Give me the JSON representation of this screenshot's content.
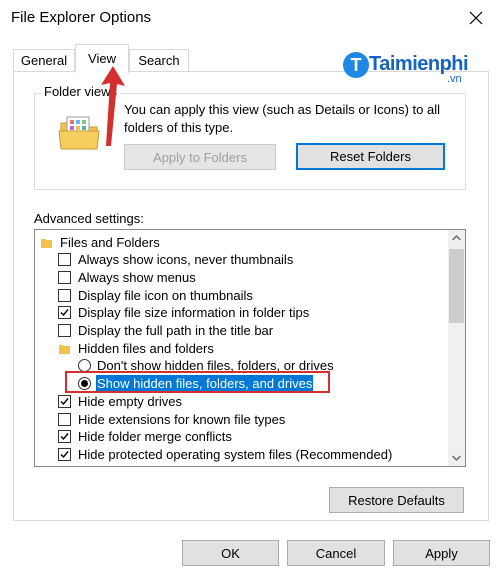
{
  "window": {
    "title": "File Explorer Options"
  },
  "tabs": [
    {
      "label": "General",
      "active": false
    },
    {
      "label": "View",
      "active": true
    },
    {
      "label": "Search",
      "active": false
    }
  ],
  "folder_views": {
    "legend": "Folder views",
    "description": "You can apply this view (such as Details or Icons) to all folders of this type.",
    "apply_button": "Apply to Folders",
    "reset_button": "Reset Folders"
  },
  "advanced": {
    "label": "Advanced settings:",
    "items": [
      {
        "type": "folder",
        "label": "Files and Folders",
        "indent": 0
      },
      {
        "type": "checkbox",
        "label": "Always show icons, never thumbnails",
        "checked": false,
        "indent": 1
      },
      {
        "type": "checkbox",
        "label": "Always show menus",
        "checked": false,
        "indent": 1
      },
      {
        "type": "checkbox",
        "label": "Display file icon on thumbnails",
        "checked": false,
        "indent": 1
      },
      {
        "type": "checkbox",
        "label": "Display file size information in folder tips",
        "checked": true,
        "indent": 1
      },
      {
        "type": "checkbox",
        "label": "Display the full path in the title bar",
        "checked": false,
        "indent": 1
      },
      {
        "type": "folder",
        "label": "Hidden files and folders",
        "indent": 1
      },
      {
        "type": "radio",
        "label": "Don't show hidden files, folders, or drives",
        "checked": false,
        "indent": 2
      },
      {
        "type": "radio",
        "label": "Show hidden files, folders, and drives",
        "checked": true,
        "selected": true,
        "indent": 2
      },
      {
        "type": "checkbox",
        "label": "Hide empty drives",
        "checked": true,
        "indent": 1
      },
      {
        "type": "checkbox",
        "label": "Hide extensions for known file types",
        "checked": false,
        "indent": 1
      },
      {
        "type": "checkbox",
        "label": "Hide folder merge conflicts",
        "checked": true,
        "indent": 1
      },
      {
        "type": "checkbox",
        "label": "Hide protected operating system files (Recommended)",
        "checked": true,
        "indent": 1
      }
    ],
    "restore_button": "Restore Defaults"
  },
  "footer": {
    "ok": "OK",
    "cancel": "Cancel",
    "apply": "Apply"
  },
  "watermark": {
    "brand": "Taimienphi",
    "tld": ".vn"
  },
  "colors": {
    "accent": "#0078d7",
    "highlight_border": "#d32f2f",
    "arrow": "#d32f2f"
  }
}
